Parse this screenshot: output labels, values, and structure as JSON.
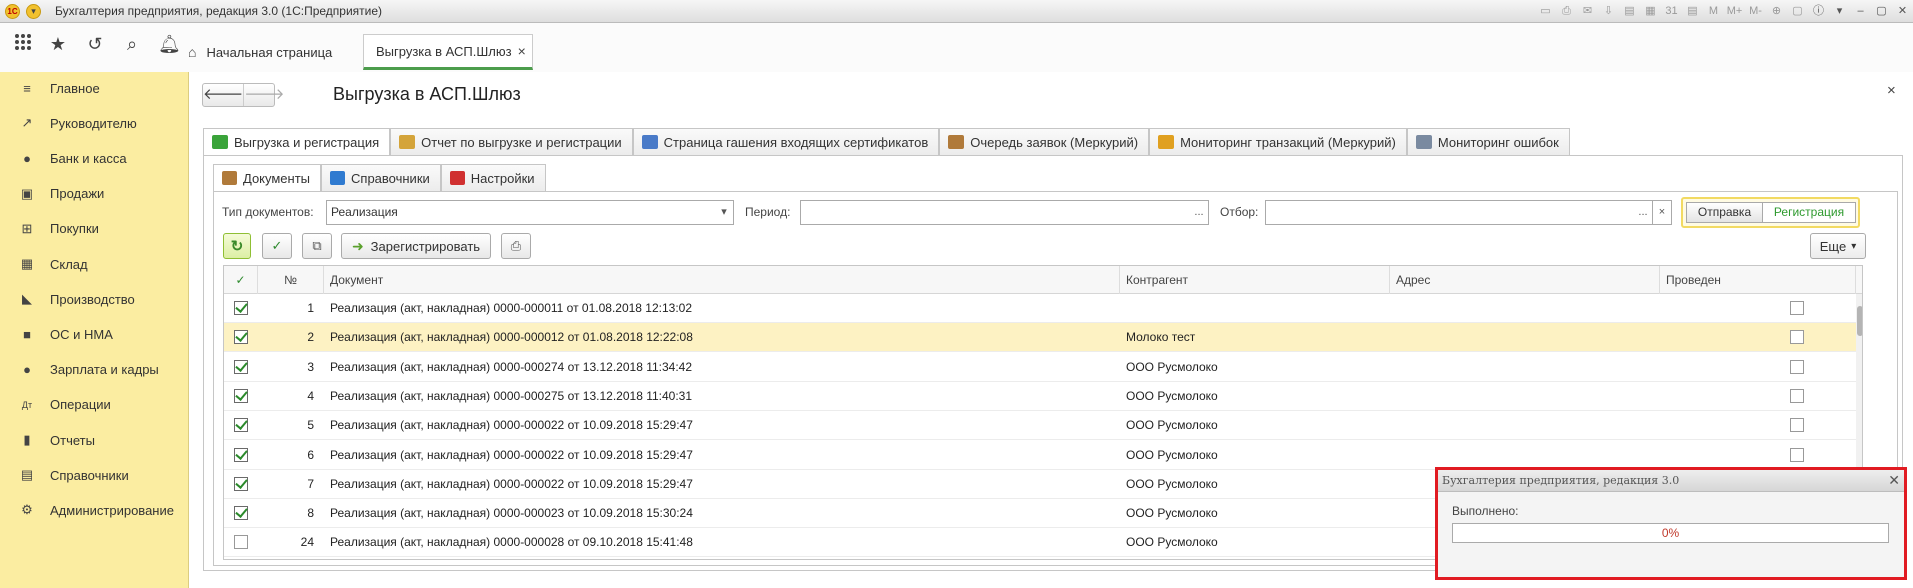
{
  "window": {
    "title": "Бухгалтерия предприятия, редакция 3.0  (1С:Предприятие)"
  },
  "title_tools": [
    "▭",
    "⎙",
    "✉",
    "⇩",
    "▤",
    "▦",
    "31",
    "▤",
    "M",
    "M+",
    "M-",
    "⊕",
    "▢",
    "ⓘ",
    "▾",
    "–",
    "▢",
    "✕"
  ],
  "toolbar": {
    "icons": [
      "apps-icon",
      "star-icon",
      "history-icon",
      "search-icon",
      "bell-icon"
    ]
  },
  "tabs": {
    "start": "Начальная страница",
    "active": "Выгрузка в АСП.Шлюз",
    "active_close": "×"
  },
  "sidebar": {
    "items": [
      {
        "label": "Главное",
        "icon": "≡"
      },
      {
        "label": "Руководителю",
        "icon": "↗"
      },
      {
        "label": "Банк и касса",
        "icon": "●"
      },
      {
        "label": "Продажи",
        "icon": "▣"
      },
      {
        "label": "Покупки",
        "icon": "⊞"
      },
      {
        "label": "Склад",
        "icon": "▦"
      },
      {
        "label": "Производство",
        "icon": "◣"
      },
      {
        "label": "ОС и НМА",
        "icon": "■"
      },
      {
        "label": "Зарплата и кадры",
        "icon": "●"
      },
      {
        "label": "Операции",
        "icon": "Дт"
      },
      {
        "label": "Отчеты",
        "icon": "▮"
      },
      {
        "label": "Справочники",
        "icon": "▤"
      },
      {
        "label": "Администрирование",
        "icon": "⚙"
      }
    ]
  },
  "page": {
    "title": "Выгрузка в АСП.Шлюз",
    "nav_back": "🡐",
    "nav_fwd": "🡒",
    "close": "×"
  },
  "main_tabs": [
    {
      "label": "Выгрузка и регистрация",
      "color": "#3aa43a"
    },
    {
      "label": "Отчет по выгрузке и регистрации",
      "color": "#d4a43a"
    },
    {
      "label": "Страница гашения входящих сертификатов",
      "color": "#4a7bc8"
    },
    {
      "label": "Очередь заявок (Меркурий)",
      "color": "#b07a3a"
    },
    {
      "label": "Мониторинг транзакций (Меркурий)",
      "color": "#e0a020"
    },
    {
      "label": "Мониторинг ошибок",
      "color": "#7a8aa0"
    }
  ],
  "sub_tabs": [
    {
      "label": "Документы",
      "color": "#b07a3a"
    },
    {
      "label": "Справочники",
      "color": "#2f7ad0"
    },
    {
      "label": "Настройки",
      "color": "#d03030"
    }
  ],
  "filters": {
    "doc_type_label": "Тип документов:",
    "doc_type_value": "Реализация",
    "period_label": "Период:",
    "period_value": "",
    "filter_label": "Отбор:",
    "filter_value": "",
    "dropdown_glyph": "▾",
    "select_glyph": "...",
    "clear_glyph": "×"
  },
  "switch": {
    "left": "Отправка",
    "right": "Регистрация"
  },
  "actions": {
    "refresh": "↻",
    "check": "✓",
    "copy": "⧉",
    "register": "Зарегистрировать",
    "print": "⎙",
    "more": "Еще",
    "more_glyph": "▾"
  },
  "table": {
    "columns": [
      "№",
      "Документ",
      "Контрагент",
      "Адрес",
      "Проведен"
    ],
    "rows": [
      {
        "checked": true,
        "num": "1",
        "doc": "Реализация (акт, накладная) 0000-000011 от 01.08.2018 12:13:02",
        "party": "",
        "addr": "",
        "posted": false
      },
      {
        "checked": true,
        "num": "2",
        "doc": "Реализация (акт, накладная) 0000-000012 от 01.08.2018 12:22:08",
        "party": "Молоко тест",
        "addr": "",
        "posted": false
      },
      {
        "checked": true,
        "num": "3",
        "doc": "Реализация (акт, накладная) 0000-000274 от 13.12.2018 11:34:42",
        "party": "ООО Русмолоко",
        "addr": "",
        "posted": false
      },
      {
        "checked": true,
        "num": "4",
        "doc": "Реализация (акт, накладная) 0000-000275 от 13.12.2018 11:40:31",
        "party": "ООО Русмолоко",
        "addr": "",
        "posted": false
      },
      {
        "checked": true,
        "num": "5",
        "doc": "Реализация (акт, накладная) 0000-000022 от 10.09.2018 15:29:47",
        "party": "ООО Русмолоко",
        "addr": "",
        "posted": false
      },
      {
        "checked": true,
        "num": "6",
        "doc": "Реализация (акт, накладная) 0000-000022 от 10.09.2018 15:29:47",
        "party": "ООО Русмолоко",
        "addr": "",
        "posted": false
      },
      {
        "checked": true,
        "num": "7",
        "doc": "Реализация (акт, накладная) 0000-000022 от 10.09.2018 15:29:47",
        "party": "ООО Русмолоко",
        "addr": "",
        "posted": false
      },
      {
        "checked": true,
        "num": "8",
        "doc": "Реализация (акт, накладная) 0000-000023 от 10.09.2018 15:30:24",
        "party": "ООО Русмолоко",
        "addr": "",
        "posted": false
      },
      {
        "checked": false,
        "num": "24",
        "doc": "Реализация (акт, накладная) 0000-000028 от 09.10.2018 15:41:48",
        "party": "ООО Русмолоко",
        "addr": "",
        "posted": false
      }
    ],
    "selected_row": 1
  },
  "dialog": {
    "title": "Бухгалтерия предприятия, редакция 3.0",
    "close": "✕",
    "label": "Выполнено:",
    "progress_text": "0%",
    "progress_value": 0
  }
}
